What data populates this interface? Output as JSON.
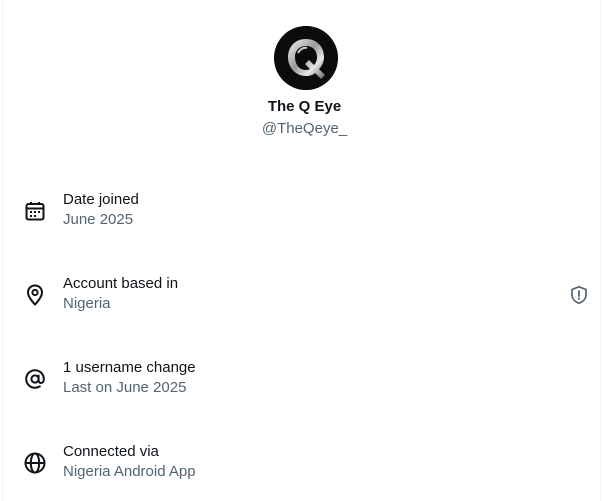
{
  "profile": {
    "display_name": "The Q Eye",
    "handle": "@TheQeye_"
  },
  "rows": [
    {
      "icon": "calendar-icon",
      "title": "Date joined",
      "subtitle": "June 2025"
    },
    {
      "icon": "location-pin-icon",
      "title": "Account based in",
      "subtitle": "Nigeria",
      "badge": "shield-alert-icon"
    },
    {
      "icon": "at-sign-icon",
      "title": "1 username change",
      "subtitle": "Last on June 2025"
    },
    {
      "icon": "globe-icon",
      "title": "Connected via",
      "subtitle": "Nigeria Android App"
    }
  ],
  "colors": {
    "text_primary": "#0f1419",
    "text_secondary": "#536471",
    "divider": "#eff3f4"
  }
}
